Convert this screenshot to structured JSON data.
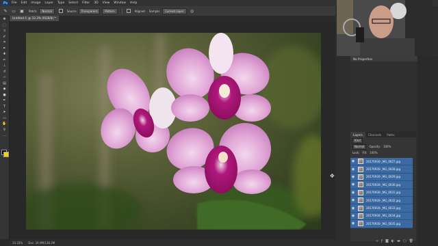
{
  "app": {
    "logo": "Ps"
  },
  "menu": [
    "File",
    "Edit",
    "Image",
    "Layer",
    "Type",
    "Select",
    "Filter",
    "3D",
    "View",
    "Window",
    "Help"
  ],
  "options": {
    "tool_icon": "patch-tool",
    "patch_label": "Patch:",
    "patch_value": "Normal",
    "source": "Source",
    "destination": "Destination",
    "transparent": "Transparent",
    "pattern": "Pattern",
    "adaptation_label": "Adaptation:",
    "adaptation_value": "Normal",
    "sample_label": "Sample:",
    "sample_value": "Current Layer",
    "aligned_label": "Aligned"
  },
  "document": {
    "tab_title": "Untitled-1 @ 33.3% (RGB/8) *"
  },
  "status": {
    "zoom": "33.33%",
    "doc": "Doc: 24.9M/138.2M"
  },
  "properties": {
    "title": "No Properties"
  },
  "layers_panel": {
    "tabs": [
      "Layers",
      "Channels",
      "Paths"
    ],
    "kind_label": "Kind",
    "blend_mode": "Normal",
    "opacity_label": "Opacity:",
    "opacity_value": "100%",
    "lock_label": "Lock:",
    "fill_label": "Fill:",
    "fill_value": "100%",
    "layers": [
      "20170930-_MG_0027.jpg",
      "20170930-_MG_0028.jpg",
      "20170930-_MG_0029.jpg",
      "20170930-_MG_0030.jpg",
      "20170930-_MG_0031.jpg",
      "20170930-_MG_0032.jpg",
      "20170930-_MG_0033.jpg",
      "20170930-_MG_0034.jpg",
      "20170930-_MG_0035.jpg"
    ]
  },
  "colors": {
    "accent_selection": "#3b6aa3",
    "foreground": "#000000",
    "background": "#f1d400"
  }
}
